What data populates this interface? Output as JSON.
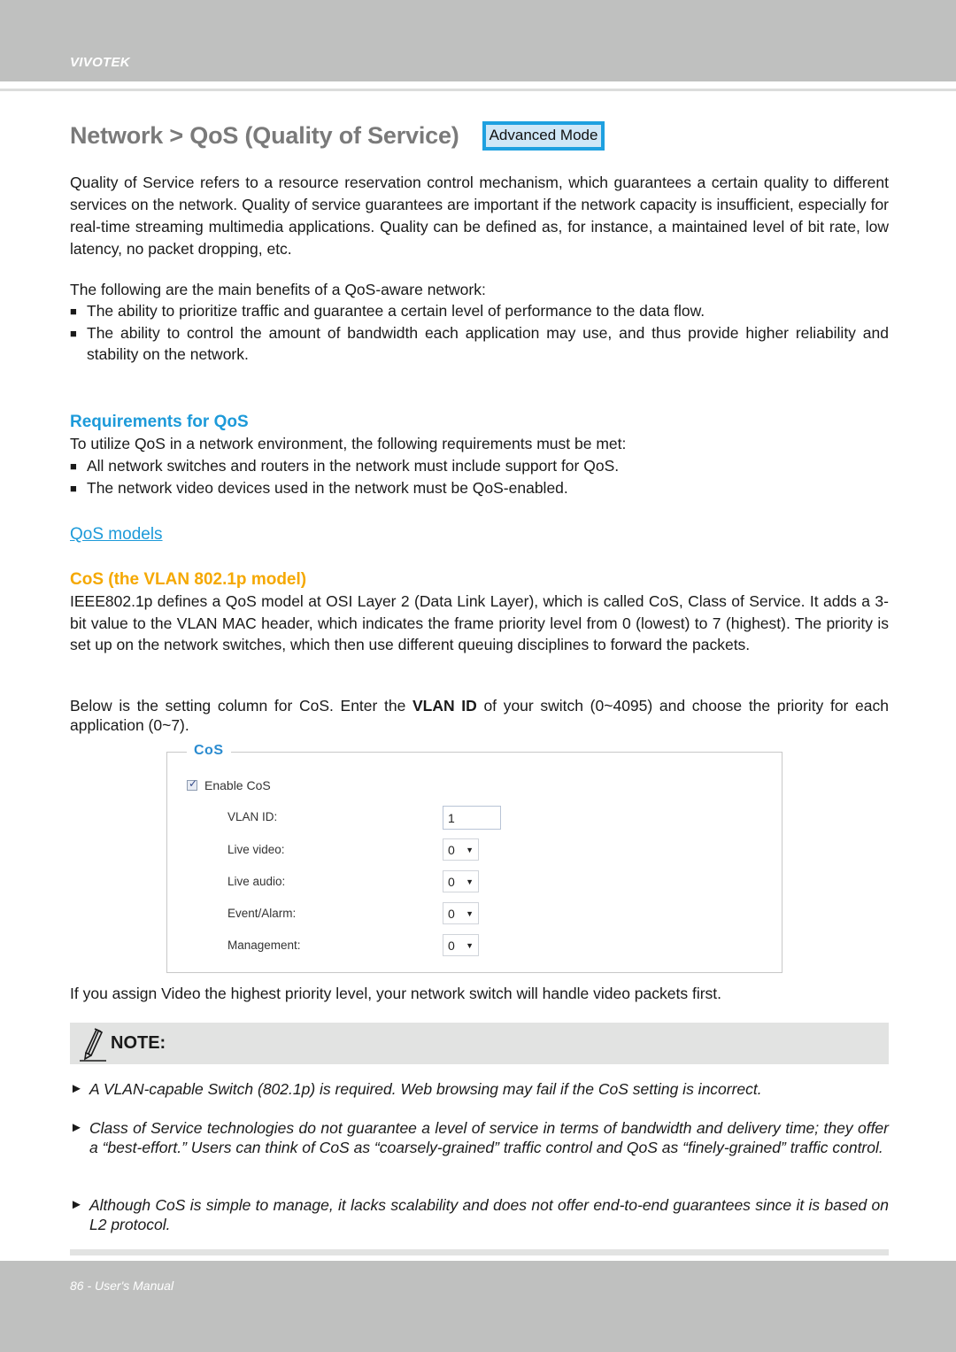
{
  "header": {
    "brand": "VIVOTEK"
  },
  "title": {
    "text": "Network > QoS (Quality of Service)",
    "badge": "Advanced Mode"
  },
  "intro": {
    "paragraph": "Quality of Service refers to a resource reservation control mechanism, which guarantees a certain quality to different services on the network. Quality of service guarantees are important if the network capacity is insufficient, especially for real-time streaming multimedia applications. Quality can be defined as, for instance, a maintained level of bit rate, low latency, no packet dropping, etc.",
    "benefits_lead": "The following are the main benefits of a QoS-aware network:",
    "benefits": [
      "The ability to prioritize traffic and guarantee a certain level of performance to the data flow.",
      "The ability to control the amount of bandwidth each application may use, and thus provide higher reliability and stability on the network."
    ]
  },
  "requirements": {
    "heading": "Requirements for QoS",
    "lead": "To utilize QoS in a network environment, the following requirements must be met:",
    "items": [
      "All network switches and routers in the network must include support for QoS.",
      "The network video devices used in the network must be QoS-enabled."
    ]
  },
  "models": {
    "link": "QoS models",
    "cos_heading": "CoS (the VLAN 802.1p model)",
    "cos_paragraph": "IEEE802.1p defines a QoS model at OSI Layer 2 (Data Link Layer), which is called CoS, Class of Service. It adds a 3-bit value to the VLAN MAC header, which indicates the frame priority level from 0 (lowest) to 7 (highest). The priority is set up on the network switches, which then use different queuing disciplines to forward the packets.",
    "setting_pre": "Below is the setting column for CoS. Enter the ",
    "setting_bold": "VLAN ID",
    "setting_post": " of your switch (0~4095) and choose the priority for each application (0~7)."
  },
  "cos_panel": {
    "legend": "CoS",
    "enable_label": "Enable CoS",
    "enable_checked": true,
    "vlan_label": "VLAN ID:",
    "vlan_value": "1",
    "rows": [
      {
        "label": "Live video:",
        "value": "0"
      },
      {
        "label": "Live audio:",
        "value": "0"
      },
      {
        "label": "Event/Alarm:",
        "value": "0"
      },
      {
        "label": "Management:",
        "value": "0"
      }
    ]
  },
  "after_panel": "If you assign Video the highest priority level, your network switch will handle video packets first.",
  "note": {
    "label": "NOTE:",
    "icon": "pencil-icon",
    "bullet_glyph": "►",
    "items": [
      "A VLAN-capable Switch (802.1p) is required. Web browsing may fail if the CoS setting is incorrect.",
      "Class of Service technologies do not guarantee a level of service in terms of bandwidth and delivery time; they offer a “best-effort.” Users can think of CoS as “coarsely-grained” traffic control and QoS as “finely-grained” traffic control.",
      "Although CoS is simple to manage, it lacks scalability and does not offer end-to-end guarantees since it is based on L2 protocol."
    ]
  },
  "footer": {
    "text": "86 - User's Manual"
  },
  "colors": {
    "band_gray": "#bfc0bf",
    "heading_blue": "#1d9ad9",
    "heading_orange": "#f5a800",
    "title_gray": "#7a7a7a",
    "badge_border": "#1ea0e0"
  }
}
